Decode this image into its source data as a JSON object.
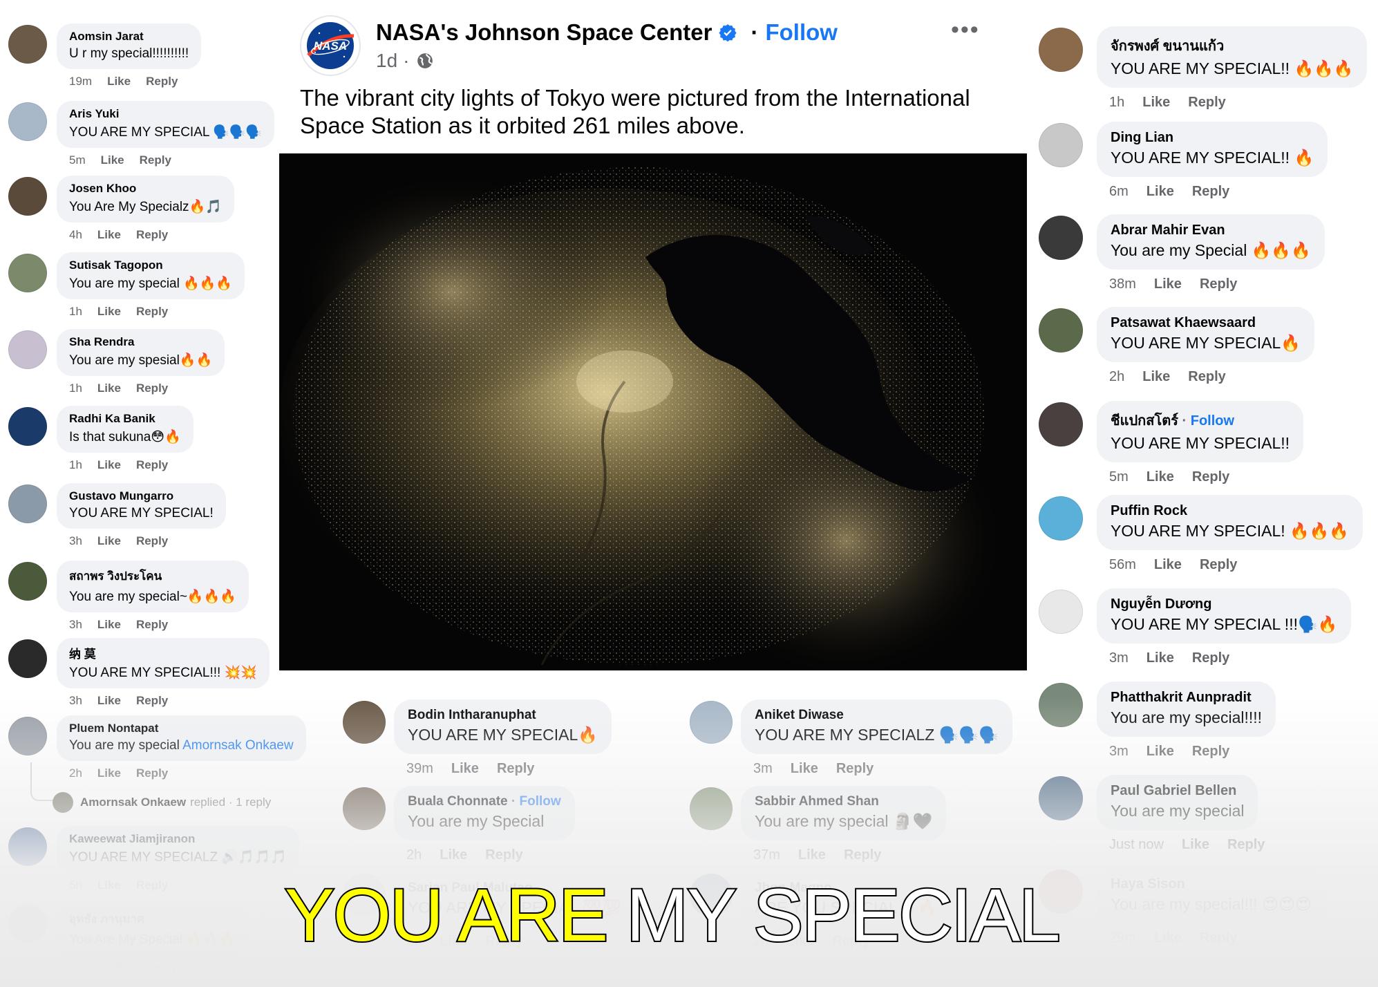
{
  "post": {
    "page_name": "NASA's Johnson Space Center",
    "follow_label": "Follow",
    "time": "1d",
    "caption": "The vibrant city lights of Tokyo were pictured from the International Space Station as it orbited 261 miles above.",
    "more_label": "•••",
    "logo_text": "NASA"
  },
  "left_comments": [
    {
      "author": "Aomsin Jarat",
      "text": "U r my special!!!!!!!!!!",
      "time": "19m"
    },
    {
      "author": "Aris Yuki",
      "text": "YOU ARE MY SPECIAL 🗣️🗣️🗣️",
      "time": "5m"
    },
    {
      "author": "Josen Khoo",
      "text": "You Are My Specialz🔥🎵",
      "time": "4h"
    },
    {
      "author": "Sutisak Tagopon",
      "text": "You are my special 🔥🔥🔥",
      "time": "1h"
    },
    {
      "author": "Sha Rendra",
      "text": "You are my spesial🔥🔥",
      "time": "1h"
    },
    {
      "author": "Radhi Ka Banik",
      "text": "Is that sukuna😳🔥",
      "time": "1h"
    },
    {
      "author": "Gustavo Mungarro",
      "text": "YOU ARE MY SPECIAL!",
      "time": "3h"
    },
    {
      "author": "สถาพร วิงประโคน",
      "text": "You are my special~🔥🔥🔥",
      "time": "3h"
    },
    {
      "author": "纳 莫",
      "text": "YOU ARE MY SPECIAL!!! 💥💥",
      "time": "3h"
    },
    {
      "author": "Pluem Nontapat",
      "text": "You are my special ",
      "tag": "Amornsak Onkaew",
      "time": "2h"
    },
    {
      "author": "Kaweewat Jiamjiranon",
      "text": "YOU ARE MY SPECIALZ 🔊🎵🎵🎵",
      "time": "5h"
    },
    {
      "author": "อุทธัง ภานุมาศ",
      "text": "You Are My Special 🔥🔥🔥",
      "time": "52m"
    }
  ],
  "reply_summary": {
    "name": "Amornsak Onkaew",
    "action": "replied",
    "count": "· 1 reply"
  },
  "right_comments": [
    {
      "author": "จักรพงศ์ ขนานแก้ว",
      "text": "YOU ARE MY SPECIAL!! 🔥🔥🔥",
      "time": "1h"
    },
    {
      "author": "Ding Lian",
      "text": "YOU ARE MY SPECIAL!! 🔥",
      "time": "6m"
    },
    {
      "author": "Abrar Mahir Evan",
      "text": "You are my Special 🔥🔥🔥",
      "time": "38m"
    },
    {
      "author": "Patsawat Khaewsaard",
      "text": "YOU ARE MY SPECIAL🔥",
      "time": "2h"
    },
    {
      "author": "ชีแปกสโตร์",
      "follow": "Follow",
      "text": "YOU ARE MY SPECIAL!!",
      "time": "5m"
    },
    {
      "author": "Puffin Rock",
      "text": "YOU ARE MY SPECIAL! 🔥🔥🔥",
      "time": "56m"
    },
    {
      "author": "Nguyễn Dương",
      "text": "YOU ARE MY SPECIAL !!!🗣️🔥",
      "time": "3m"
    },
    {
      "author": "Phatthakrit Aunpradit",
      "text": "You are my special!!!!",
      "time": "3m"
    },
    {
      "author": "Paul Gabriel Bellen",
      "text": "You are my special",
      "time": "Just now"
    },
    {
      "author": "Haya Sison",
      "text": "You are my special!!! 😍😍😍",
      "time": "29m"
    }
  ],
  "bottom_comments": [
    {
      "author": "Bodin Intharanuphat",
      "text": "YOU ARE MY SPECIAL🔥",
      "time": "39m"
    },
    {
      "author": "Aniket Diwase",
      "text": "YOU ARE MY SPECIALZ 🗣️🗣️🗣️",
      "time": "3m"
    },
    {
      "author": "Buala Chonnate",
      "follow": "Follow",
      "text": "You are my Special",
      "time": "2h"
    },
    {
      "author": "Sabbir Ahmed Shan",
      "text": "You are my special 🗿🖤",
      "time": "37m"
    },
    {
      "author": "Sarian Paul Malutao",
      "text": "YOU ARE MY SPECIAL 💯💯",
      "time": "2h"
    },
    {
      "author": "Jhon Magno",
      "text": "ARE YOU SPECIAL🔥🔥",
      "time": "2h"
    }
  ],
  "labels": {
    "like": "Like",
    "reply": "Reply"
  },
  "overlay": {
    "part1": "YOU ARE ",
    "part2": "MY SPECIAL"
  },
  "colors": {
    "link": "#1877f2",
    "bubble": "#f0f2f5",
    "meta": "#65676b",
    "overlay_yellow": "#ffff00",
    "overlay_white": "#ffffff"
  }
}
